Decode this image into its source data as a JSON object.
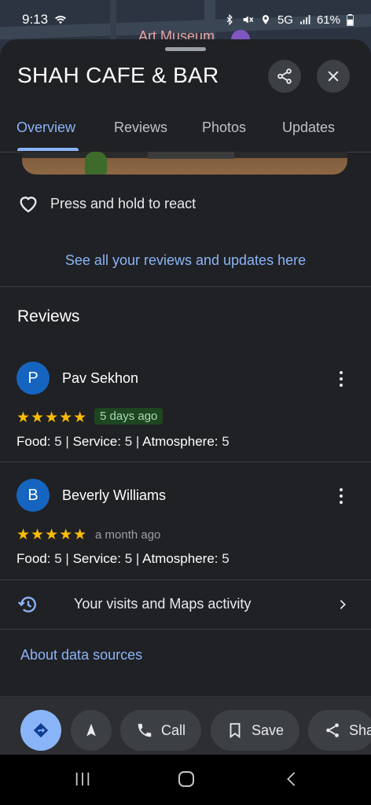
{
  "status": {
    "time": "9:13",
    "network": "5G",
    "battery": "61%"
  },
  "map": {
    "label": "Art Museum"
  },
  "place": {
    "title": "SHAH CAFE & BAR"
  },
  "tabs": [
    "Overview",
    "Reviews",
    "Photos",
    "Updates"
  ],
  "react": {
    "label": "Press and hold to react"
  },
  "see_all_link": "See all your reviews and updates here",
  "reviews": {
    "heading": "Reviews",
    "items": [
      {
        "initial": "P",
        "name": "Pav Sekhon",
        "stars": "★★★★★",
        "time": "5 days ago",
        "food_label": "Food:",
        "food": "5",
        "service_label": "Service:",
        "service": "5",
        "atmosphere_label": "Atmosphere:",
        "atmosphere": "5"
      },
      {
        "initial": "B",
        "name": "Beverly Williams",
        "stars": "★★★★★",
        "time": "a month ago",
        "food_label": "Food:",
        "food": "5",
        "service_label": "Service:",
        "service": "5",
        "atmosphere_label": "Atmosphere:",
        "atmosphere": "5"
      }
    ]
  },
  "activity": {
    "label": "Your visits and Maps activity"
  },
  "about_link": "About data sources",
  "actions": {
    "call": "Call",
    "save": "Save",
    "share": "Sha"
  },
  "colors": {
    "accent": "#8ab4f8",
    "star": "#fbbc04",
    "background": "#202124",
    "avatar": "#1565c0"
  }
}
